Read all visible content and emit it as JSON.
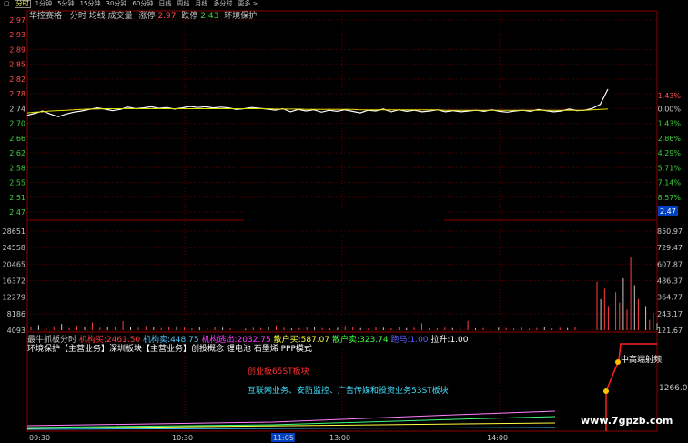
{
  "toolbar": {
    "icon_label": "▢",
    "tabs": [
      {
        "label": "分时",
        "active": true
      },
      {
        "label": "1分钟"
      },
      {
        "label": "5分钟"
      },
      {
        "label": "15分钟"
      },
      {
        "label": "30分钟"
      },
      {
        "label": "60分钟"
      },
      {
        "label": "日线"
      },
      {
        "label": "周线"
      },
      {
        "label": "月线"
      },
      {
        "label": "多分时"
      },
      {
        "label": "更多 >"
      }
    ]
  },
  "stock": {
    "name": "华控赛格",
    "label_fenshi": "分时",
    "label_junxian": "均线",
    "label_volume": "成交量",
    "label_zhangting": "涨停",
    "zhangting_value": "2.97",
    "label_dieting": "跌停",
    "dieting_value": "2.43",
    "tag": "环境保护"
  },
  "price_axis": {
    "left_labels": [
      "2.97",
      "2.93",
      "2.89",
      "2.85",
      "2.82",
      "2.78",
      "2.74",
      "2.70",
      "2.66",
      "2.62",
      "2.58",
      "2.55",
      "2.51",
      "2.47"
    ],
    "right_labels": [
      "1.43%",
      "0.00%",
      "1.43%",
      "2.86%",
      "4.29%",
      "5.71%",
      "7.14%",
      "8.57%"
    ],
    "current_price": "2.47"
  },
  "volume_axis": {
    "left_labels": [
      "28651",
      "24558",
      "20465",
      "16372",
      "12279",
      "8186",
      "4093"
    ],
    "right_labels": [
      "850.97",
      "729.47",
      "607.87",
      "486.37",
      "364.77",
      "243.17",
      "121.67"
    ]
  },
  "indicator": {
    "title": "最牛抓板分时",
    "jigou_mai_label": "机构买:",
    "jigou_mai_value": "2461.50",
    "jigou_mai2_label": "机构卖:",
    "jigou_mai2_value": "448.75",
    "jigou_tuichu_label": "机构逃出:",
    "jigou_tuichu_value": "2032.75",
    "sanhu_mai_label": "散户买:",
    "sanhu_mai_value": "587.07",
    "sanhu_mai2_label": "散户卖:",
    "sanhu_mai2_value": "323.74",
    "blue_label": "跑马:",
    "blue_value": "1.00",
    "lasheng_label": "拉升:",
    "lasheng_value": "1.00",
    "concepts": "环境保护【主营业务】深圳板块【主营业务】创投概念 锂电池 石墨烯 PPP模式",
    "board1": "创业板65ST板块",
    "board2": "互联网业务、安防监控、广告传媒和投资业务53ST板块",
    "marker_label": "中高端射频",
    "right_value": "1266.0"
  },
  "time_axis": {
    "labels": [
      "09:30",
      "10:30",
      "11:05",
      "13:00",
      "14:00"
    ],
    "cursor": "11:05"
  },
  "watermark": "www.7gpzb.com",
  "chart_data": {
    "type": "line",
    "title": "华控赛格 分时",
    "ylim": [
      2.47,
      2.97
    ],
    "series": [
      {
        "name": "分时",
        "values": [
          2.722,
          2.727,
          2.733,
          2.725,
          2.718,
          2.725,
          2.73,
          2.733,
          2.737,
          2.741,
          2.738,
          2.734,
          2.737,
          2.743,
          2.739,
          2.741,
          2.744,
          2.74,
          2.742,
          2.738,
          2.741,
          2.745,
          2.742,
          2.744,
          2.741,
          2.743,
          2.741,
          2.737,
          2.739,
          2.742,
          2.74,
          2.738,
          2.735,
          2.739,
          2.731,
          2.737,
          2.733,
          2.736,
          2.73,
          2.735,
          2.732,
          2.736,
          2.732,
          2.728,
          2.735,
          2.733,
          2.738,
          2.731,
          2.736,
          2.732,
          2.735,
          2.731,
          2.733,
          2.736,
          2.731,
          2.734,
          2.731,
          2.733,
          2.735,
          2.732,
          2.736,
          2.732,
          2.73,
          2.733,
          2.735,
          2.732,
          2.737,
          2.734,
          2.731,
          2.733,
          2.738,
          2.734,
          2.735,
          2.74,
          2.75,
          2.79
        ]
      },
      {
        "name": "均线",
        "values": [
          2.728,
          2.73,
          2.731,
          2.733,
          2.734,
          2.735,
          2.736,
          2.737,
          2.738,
          2.738,
          2.739,
          2.739,
          2.739,
          2.739,
          2.739,
          2.739,
          2.739,
          2.739,
          2.739,
          2.739,
          2.739,
          2.739,
          2.739,
          2.739,
          2.739,
          2.739,
          2.739,
          2.739,
          2.739,
          2.739,
          2.739,
          2.739,
          2.738,
          2.738,
          2.738,
          2.738,
          2.737,
          2.737,
          2.737,
          2.737,
          2.737,
          2.737,
          2.737,
          2.736,
          2.736,
          2.736,
          2.736,
          2.736,
          2.736,
          2.736,
          2.736,
          2.736,
          2.736,
          2.736,
          2.735,
          2.735,
          2.735,
          2.735,
          2.735,
          2.735,
          2.735,
          2.735,
          2.735,
          2.735,
          2.735,
          2.735,
          2.735,
          2.735,
          2.735,
          2.735,
          2.735,
          2.735,
          2.735,
          2.736,
          2.737,
          2.738
        ]
      }
    ],
    "volume_ylim": [
      0,
      28651
    ],
    "volume": [
      900,
      1500,
      700,
      1100,
      1800,
      600,
      1300,
      900,
      2200,
      700,
      800,
      1000,
      2600,
      900,
      700,
      1200,
      800,
      600,
      900,
      1100,
      700,
      500,
      800,
      600,
      1000,
      700,
      500,
      900,
      400,
      700,
      600,
      900,
      1400,
      700,
      500,
      600,
      800,
      1000,
      600,
      500,
      700,
      1200,
      900,
      600,
      400,
      800,
      700,
      500,
      900,
      600,
      700,
      2000,
      600,
      500,
      700,
      600,
      900,
      2700,
      500,
      600,
      800,
      700,
      600,
      500,
      700,
      400,
      600,
      800,
      500,
      700,
      600,
      900,
      14000,
      9000,
      12000,
      7000,
      19000,
      11000,
      8000,
      15000,
      6000,
      21000,
      13000,
      9000,
      4000,
      7000,
      3000,
      5000,
      2000
    ]
  }
}
